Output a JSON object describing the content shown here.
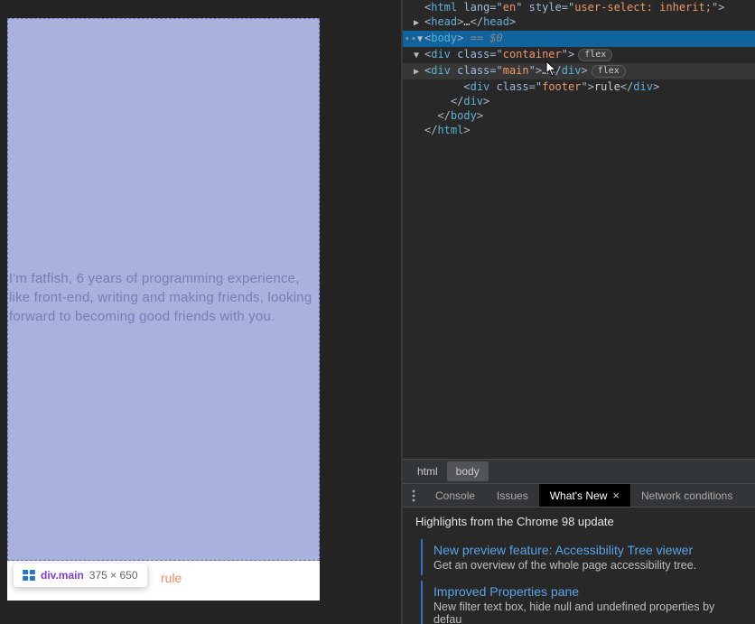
{
  "preview": {
    "main_text": "I'm fatfish, 6 years of programming experience, like front-end, writing and making friends, looking forward to becoming good friends with you.",
    "footer_peek": "rule",
    "tooltip": {
      "selector": "div.main",
      "dims": "375 × 650"
    }
  },
  "dom": {
    "l1": {
      "tag": "html",
      "attr1": "lang",
      "val1": "en",
      "attr2": "style",
      "val2": "user-select: inherit;"
    },
    "l2": {
      "tag_open": "head",
      "tag_close": "head"
    },
    "l3": {
      "tag": "body",
      "eq": " == ",
      "var": "$0"
    },
    "l4": {
      "tag": "div",
      "attr": "class",
      "val": "container",
      "badge": "flex"
    },
    "l5": {
      "tag": "div",
      "attr": "class",
      "val": "main",
      "close": "div",
      "badge": "flex"
    },
    "l6": {
      "tag": "div",
      "attr": "class",
      "val": "footer",
      "text": "rule",
      "close": "div"
    },
    "l7": {
      "close": "div"
    },
    "l8": {
      "close": "body"
    },
    "l9": {
      "close": "html"
    }
  },
  "breadcrumb": {
    "a": "html",
    "b": "body"
  },
  "drawer": {
    "tabs": {
      "console": "Console",
      "issues": "Issues",
      "whatsnew": "What's New",
      "network": "Network conditions"
    },
    "heading": "Highlights from the Chrome 98 update",
    "card1": {
      "title": "New preview feature: Accessibility Tree viewer",
      "sub": "Get an overview of the whole page accessibility tree."
    },
    "card2": {
      "title": "Improved Properties pane",
      "sub": "New filter text box, hide null and undefined properties by defau"
    }
  }
}
